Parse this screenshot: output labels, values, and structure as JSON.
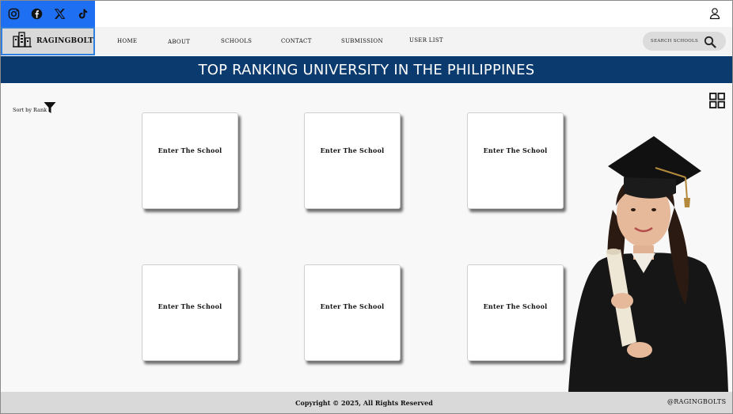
{
  "social": {
    "icons": [
      "instagram-icon",
      "facebook-icon",
      "x-icon",
      "tiktok-icon"
    ],
    "bar_color": "#1f6ff2"
  },
  "brand": {
    "name": "RAGINGBOLT"
  },
  "nav": {
    "items": [
      "HOME",
      "ABOUT",
      "SCHOOLS",
      "CONTACT",
      "SUBMISSION",
      "USER LIST"
    ]
  },
  "search": {
    "placeholder": "SEARCH SCHOOLS"
  },
  "banner": {
    "title": "TOP RANKING UNIVERSITY IN THE PHILIPPINES",
    "color": "#0a3a6e"
  },
  "toolbar": {
    "sort_label": "Sort by Rank"
  },
  "cards": [
    {
      "label": "Enter The School"
    },
    {
      "label": "Enter The School"
    },
    {
      "label": "Enter The School"
    },
    {
      "label": "Enter The School"
    },
    {
      "label": "Enter The School"
    },
    {
      "label": "Enter The School"
    }
  ],
  "footer": {
    "copyright": "Copyright © 2025, All Rights Reserved",
    "handle": "@RAGINGBOLTS"
  }
}
